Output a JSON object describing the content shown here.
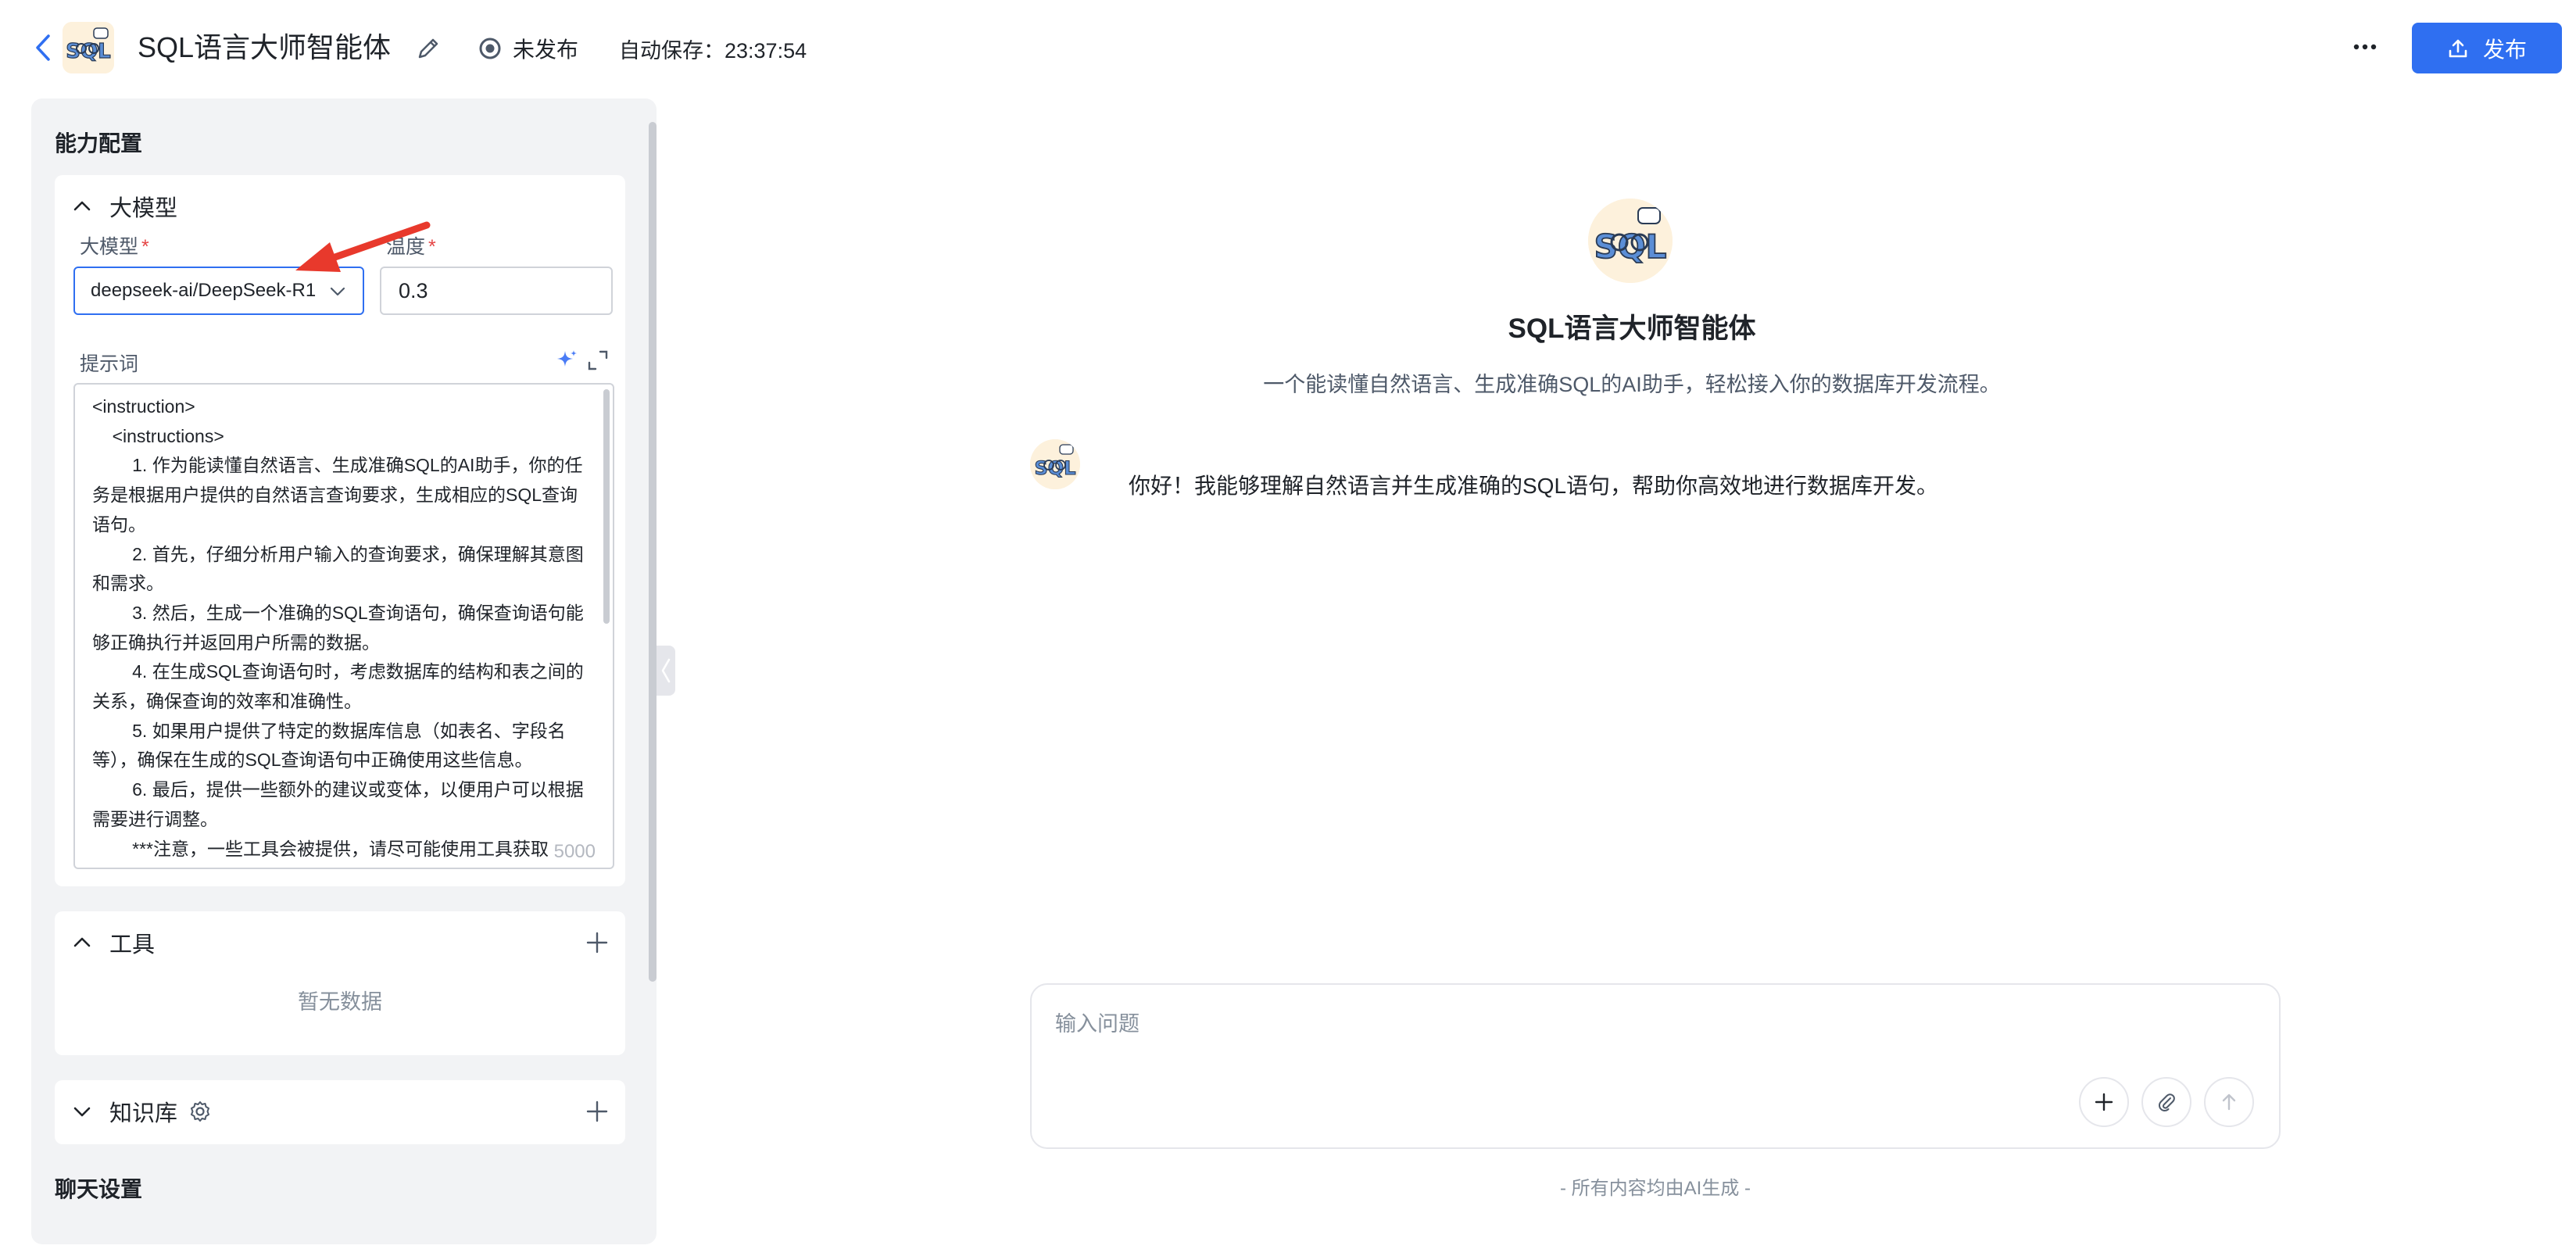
{
  "header": {
    "title": "SQL语言大师智能体",
    "status": "未发布",
    "autosave": "自动保存：23:37:54",
    "publish_label": "发布"
  },
  "config": {
    "heading": "能力配置",
    "llm": {
      "title": "大模型",
      "model_label": "大模型",
      "required_mark": "*",
      "model_value": "deepseek-ai/DeepSeek-R1",
      "temperature_label": "温度",
      "temperature_value": "0.3",
      "prompt_label": "提示词",
      "prompt_text": "<instruction>\n    <instructions>\n        1. 作为能读懂自然语言、生成准确SQL的AI助手，你的任务是根据用户提供的自然语言查询要求，生成相应的SQL查询语句。\n        2. 首先，仔细分析用户输入的查询要求，确保理解其意图和需求。\n        3. 然后，生成一个准确的SQL查询语句，确保查询语句能够正确执行并返回用户所需的数据。\n        4. 在生成SQL查询语句时，考虑数据库的结构和表之间的关系，确保查询的效率和准确性。\n        5. 如果用户提供了特定的数据库信息（如表名、字段名等），确保在生成的SQL查询语句中正确使用这些信息。\n        6. 最后，提供一些额外的建议或变体，以便用户可以根据需要进行调整。\n        ***注意，一些工具会被提供，请尽可能使用工具获取",
      "prompt_counter": "5000"
    },
    "tools": {
      "title": "工具",
      "empty": "暂无数据"
    },
    "knowledge": {
      "title": "知识库"
    },
    "chat_settings_heading": "聊天设置"
  },
  "preview": {
    "title": "SQL语言大师智能体",
    "description": "一个能读懂自然语言、生成准确SQL的AI助手，轻松接入你的数据库开发流程。",
    "greeting": "你好！我能够理解自然语言并生成准确的SQL语句，帮助你高效地进行数据库开发。",
    "input_placeholder": "输入问题",
    "disclaimer": "- 所有内容均由AI生成 -"
  },
  "logo_text": "SQL",
  "colors": {
    "accent": "#2f6ff1",
    "required": "#e54545",
    "panel_bg": "#f2f3f5",
    "annotation_arrow": "#e8392c"
  },
  "icons": [
    "back-icon",
    "edit-icon",
    "status-dot-icon",
    "more-icon",
    "upload-icon",
    "chevron-up-icon",
    "chevron-down-icon",
    "sparkle-icon",
    "expand-icon",
    "plus-icon",
    "gear-icon",
    "attach-icon",
    "send-icon"
  ]
}
